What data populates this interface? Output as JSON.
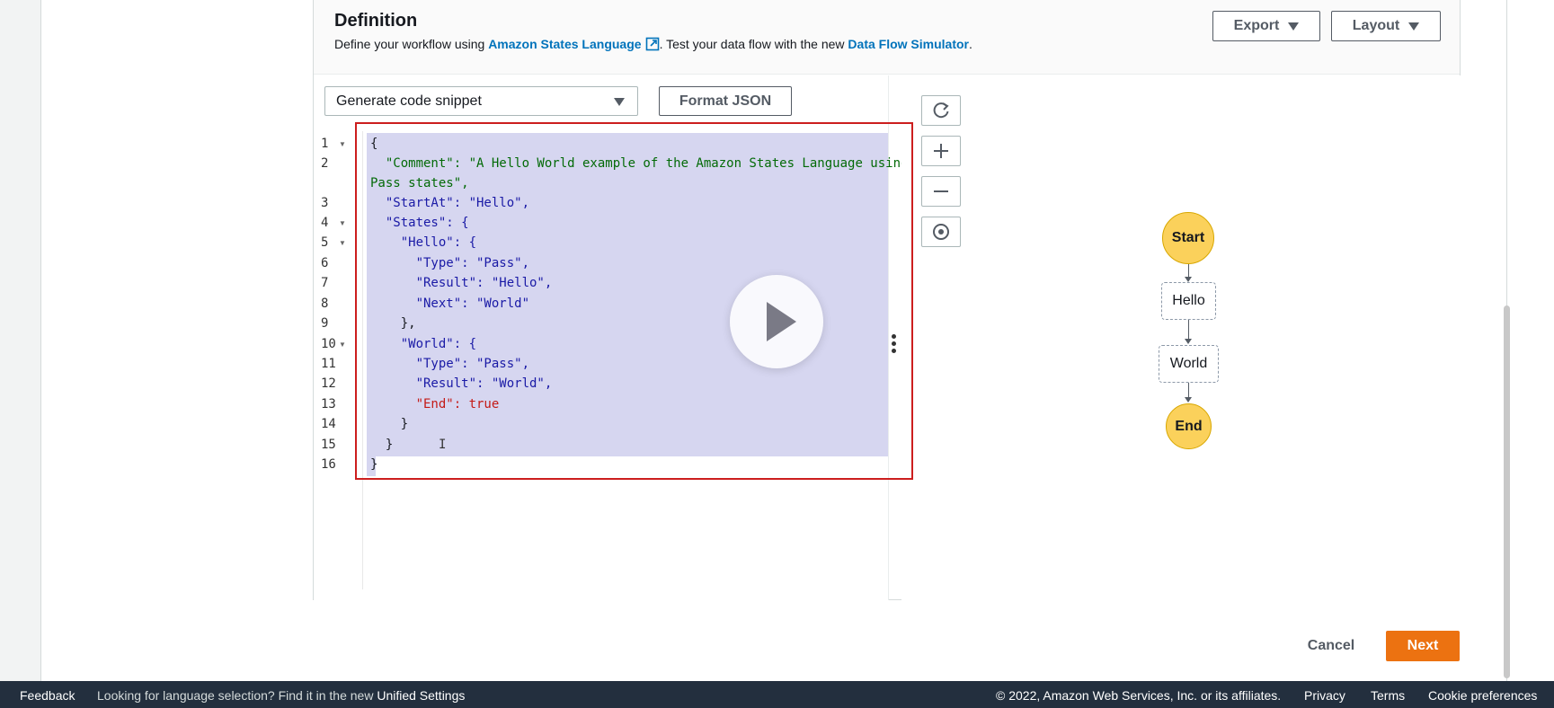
{
  "definition": {
    "title": "Definition",
    "desc_prefix": "Define your workflow using ",
    "asl_link": "Amazon States Language",
    "desc_mid": ". Test your data flow with the new ",
    "simulator_link": "Data Flow Simulator",
    "desc_suffix": "."
  },
  "header_buttons": {
    "export": "Export",
    "layout": "Layout"
  },
  "editor": {
    "snippet_select": "Generate code snippet",
    "format_button": "Format JSON",
    "line_numbers": [
      "1",
      "2",
      "",
      "3",
      "4",
      "5",
      "6",
      "7",
      "8",
      "9",
      "10",
      "11",
      "12",
      "13",
      "14",
      "15",
      "16"
    ],
    "code_lines": [
      "{",
      "  \"Comment\": \"A Hello World example of the Amazon States Language using",
      "Pass states\",",
      "  \"StartAt\": \"Hello\",",
      "  \"States\": {",
      "    \"Hello\": {",
      "      \"Type\": \"Pass\",",
      "      \"Result\": \"Hello\",",
      "      \"Next\": \"World\"",
      "    },",
      "    \"World\": {",
      "      \"Type\": \"Pass\",",
      "      \"Result\": \"World\",",
      "      \"End\": true",
      "    }",
      "  }",
      "}"
    ]
  },
  "graph": {
    "nodes": [
      "Start",
      "Hello",
      "World",
      "End"
    ],
    "start_color": "#fbd15b"
  },
  "actions": {
    "cancel": "Cancel",
    "next": "Next",
    "next_color": "#ec7211"
  },
  "footer": {
    "feedback": "Feedback",
    "language_msg": "Looking for language selection? Find it in the new ",
    "unified_settings": "Unified Settings",
    "copyright": "© 2022, Amazon Web Services, Inc. or its affiliates.",
    "privacy": "Privacy",
    "terms": "Terms",
    "cookies": "Cookie preferences"
  }
}
